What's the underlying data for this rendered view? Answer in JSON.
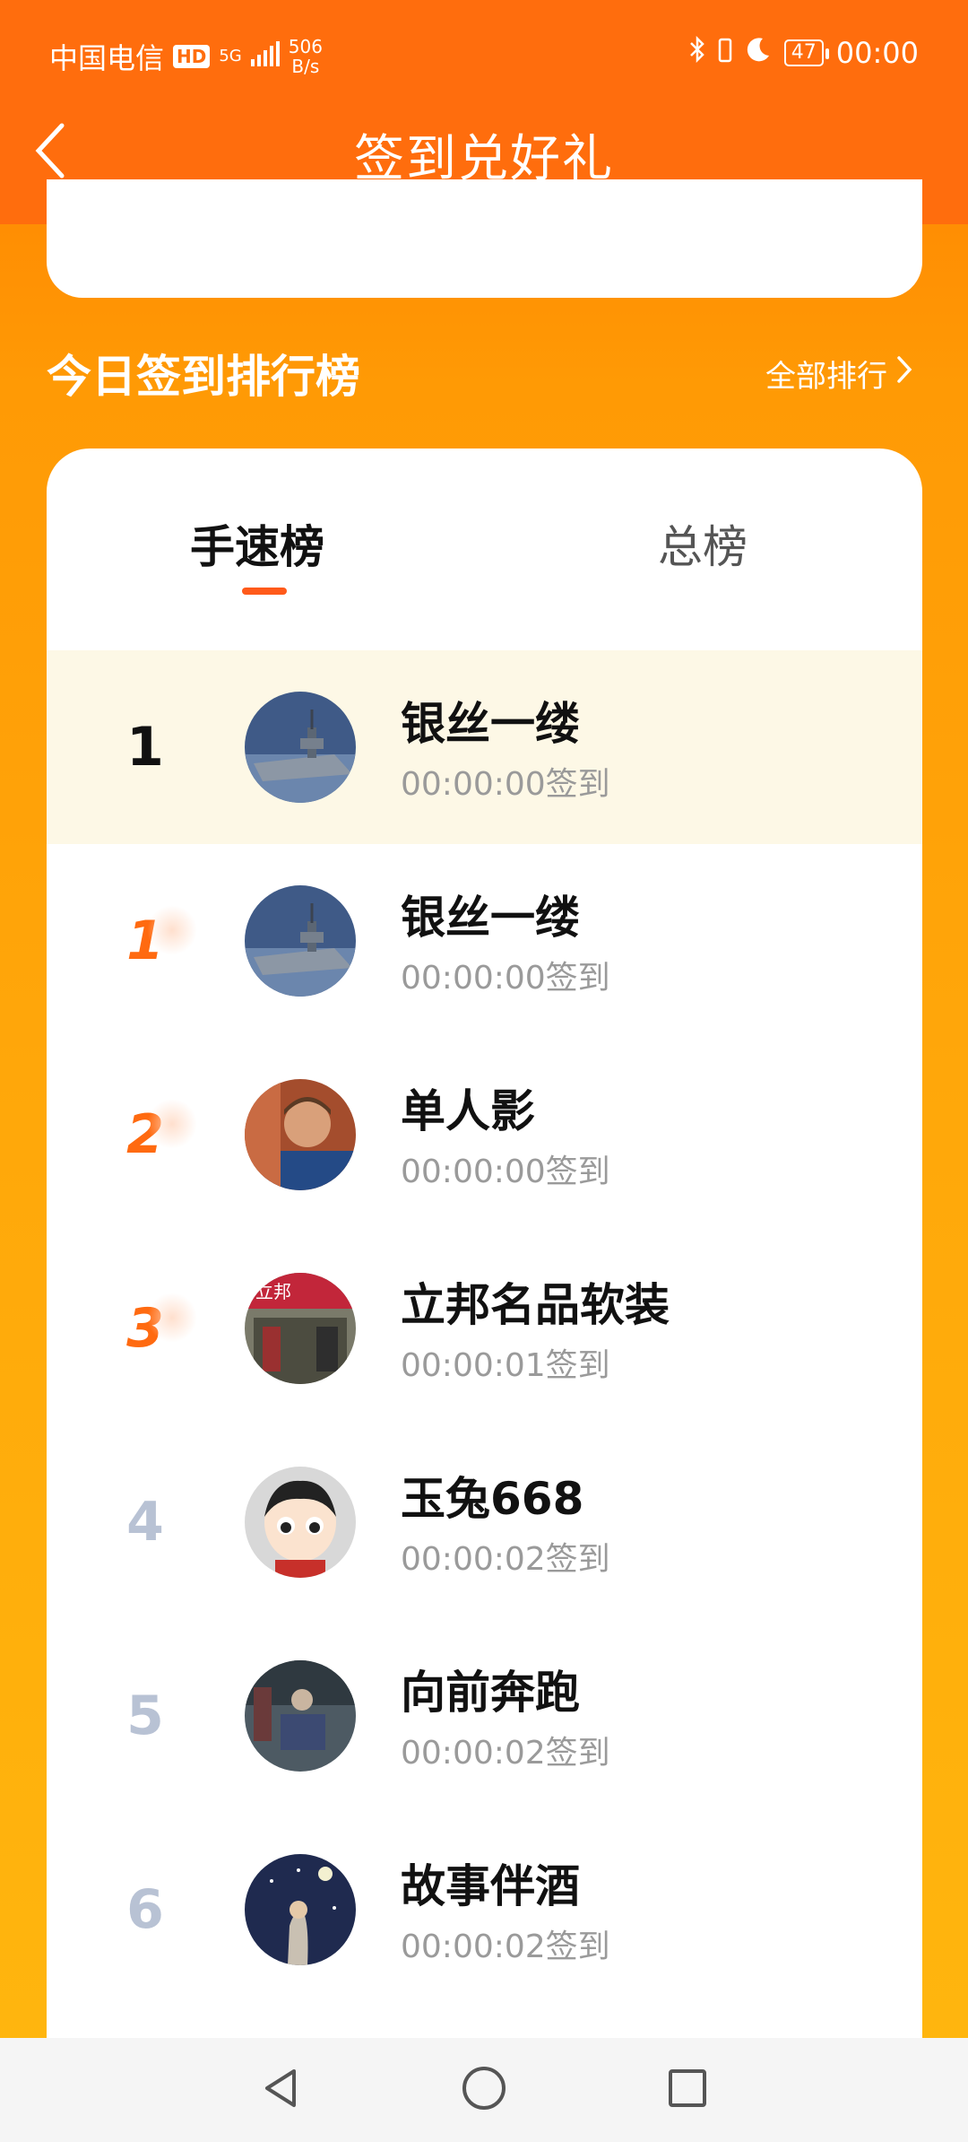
{
  "status_bar": {
    "carrier": "中国电信",
    "hd": "HD",
    "network": "5G",
    "speed_value": "506",
    "speed_unit": "B/s",
    "battery": "47",
    "time": "00:00"
  },
  "header": {
    "title": "签到兑好礼"
  },
  "ranking": {
    "section_title": "今日签到排行榜",
    "all_rank_label": "全部排行",
    "tabs": [
      {
        "label": "手速榜",
        "active": true
      },
      {
        "label": "总榜",
        "active": false
      }
    ],
    "me": {
      "rank": "1",
      "name": "银丝一缕",
      "time": "00:00:00签到"
    },
    "rows": [
      {
        "rank": "1",
        "name": "银丝一缕",
        "time": "00:00:00签到"
      },
      {
        "rank": "2",
        "name": "单人影",
        "time": "00:00:00签到"
      },
      {
        "rank": "3",
        "name": "立邦名品软装",
        "time": "00:00:01签到"
      },
      {
        "rank": "4",
        "name": "玉兔668",
        "time": "00:00:02签到"
      },
      {
        "rank": "5",
        "name": "向前奔跑",
        "time": "00:00:02签到"
      },
      {
        "rank": "6",
        "name": "故事伴酒",
        "time": "00:00:02签到"
      }
    ],
    "avatar_signage": "立邦"
  },
  "colors": {
    "header": "#ff6d0d",
    "accent": "#ff5a1a",
    "medal": "#ff6a10",
    "grey_rank": "#b8c2d4"
  },
  "icons": {
    "back": "chevron-left-icon",
    "all_rank": "chevron-right-icon",
    "nav_back": "triangle-back-icon",
    "nav_home": "circle-home-icon",
    "nav_recent": "square-recent-icon"
  }
}
